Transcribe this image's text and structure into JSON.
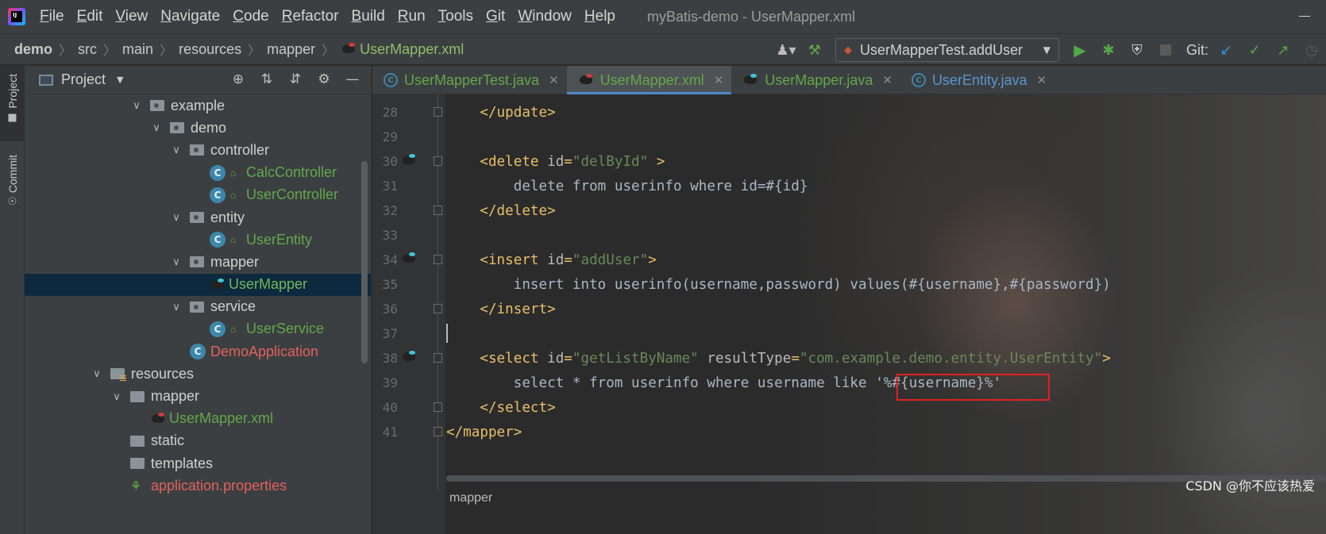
{
  "menubar": {
    "items": [
      "File",
      "Edit",
      "View",
      "Navigate",
      "Code",
      "Refactor",
      "Build",
      "Run",
      "Tools",
      "Git",
      "Window",
      "Help"
    ],
    "window_title": "myBatis-demo - UserMapper.xml"
  },
  "navbar": {
    "breadcrumb": [
      "demo",
      "src",
      "main",
      "resources",
      "mapper"
    ],
    "current_file": "UserMapper.xml",
    "run_config": "UserMapperTest.addUser",
    "git_label": "Git:"
  },
  "stripe": {
    "project": "Project",
    "commit": "Commit"
  },
  "project_panel": {
    "title": "Project",
    "tree": [
      {
        "label": "example",
        "type": "package",
        "indent": 0,
        "expanded": true
      },
      {
        "label": "demo",
        "type": "package",
        "indent": 1,
        "expanded": true
      },
      {
        "label": "controller",
        "type": "package",
        "indent": 2,
        "expanded": true
      },
      {
        "label": "CalcController",
        "type": "class",
        "indent": 3
      },
      {
        "label": "UserController",
        "type": "class",
        "indent": 3
      },
      {
        "label": "entity",
        "type": "package",
        "indent": 2,
        "expanded": true
      },
      {
        "label": "UserEntity",
        "type": "class",
        "indent": 3
      },
      {
        "label": "mapper",
        "type": "package",
        "indent": 2,
        "expanded": true
      },
      {
        "label": "UserMapper",
        "type": "mapper",
        "indent": 3,
        "selected": true
      },
      {
        "label": "service",
        "type": "package",
        "indent": 2,
        "expanded": true
      },
      {
        "label": "UserService",
        "type": "class",
        "indent": 3
      },
      {
        "label": "DemoApplication",
        "type": "app",
        "indent": 2
      },
      {
        "label": "resources",
        "type": "resources",
        "indent": -2,
        "expanded": true
      },
      {
        "label": "mapper",
        "type": "folder",
        "indent": -1,
        "expanded": true
      },
      {
        "label": "UserMapper.xml",
        "type": "xml",
        "indent": 0
      },
      {
        "label": "static",
        "type": "folder-plain",
        "indent": -1
      },
      {
        "label": "templates",
        "type": "folder-plain",
        "indent": -1
      },
      {
        "label": "application.properties",
        "type": "properties",
        "indent": -1
      }
    ]
  },
  "editor": {
    "tabs": [
      {
        "label": "UserMapperTest.java",
        "icon": "class-icon",
        "active": false
      },
      {
        "label": "UserMapper.xml",
        "icon": "mybatis-icon",
        "active": true
      },
      {
        "label": "UserMapper.java",
        "icon": "mybatis-icon",
        "active": false
      },
      {
        "label": "UserEntity.java",
        "icon": "class-icon",
        "active": false
      }
    ],
    "lines": [
      {
        "n": "28",
        "parts": [
          [
            "tag",
            "    </update>"
          ]
        ]
      },
      {
        "n": "29",
        "parts": []
      },
      {
        "n": "30",
        "gutter": true,
        "parts": [
          [
            "tag",
            "    <delete "
          ],
          [
            "attr",
            "id"
          ],
          [
            "tag",
            "="
          ],
          [
            "val",
            "\"delById\""
          ],
          [
            "tag",
            " >"
          ]
        ]
      },
      {
        "n": "31",
        "parts": [
          [
            "txt",
            "        delete from userinfo where id=#{id}"
          ]
        ]
      },
      {
        "n": "32",
        "parts": [
          [
            "tag",
            "    </delete>"
          ]
        ]
      },
      {
        "n": "33",
        "parts": []
      },
      {
        "n": "34",
        "gutter": true,
        "parts": [
          [
            "tag",
            "    <insert "
          ],
          [
            "attr",
            "id"
          ],
          [
            "tag",
            "="
          ],
          [
            "val",
            "\"addUser\""
          ],
          [
            "tag",
            ">"
          ]
        ]
      },
      {
        "n": "35",
        "parts": [
          [
            "txt",
            "        insert into userinfo(username,password) values(#{username},#{password})"
          ]
        ]
      },
      {
        "n": "36",
        "parts": [
          [
            "tag",
            "    </insert>"
          ]
        ]
      },
      {
        "n": "37",
        "caret": true,
        "parts": []
      },
      {
        "n": "38",
        "gutter": true,
        "parts": [
          [
            "tag",
            "    <select "
          ],
          [
            "attr",
            "id"
          ],
          [
            "tag",
            "="
          ],
          [
            "val",
            "\"getListByName\""
          ],
          [
            "attr",
            " resultType"
          ],
          [
            "tag",
            "="
          ],
          [
            "val",
            "\"com.example.demo.entity.UserEntity\""
          ],
          [
            "tag",
            ">"
          ]
        ]
      },
      {
        "n": "39",
        "parts": [
          [
            "txt",
            "        select * from userinfo where username like '%#{username}%'"
          ]
        ]
      },
      {
        "n": "40",
        "parts": [
          [
            "tag",
            "    </select>"
          ]
        ]
      },
      {
        "n": "41",
        "parts": [
          [
            "tag",
            "</mapper>"
          ]
        ]
      }
    ],
    "footer_breadcrumb": "mapper",
    "watermark": "CSDN @你不应该热爱"
  },
  "colors": {
    "accent": "#4a88c7",
    "highlight_box": "#e02020"
  }
}
